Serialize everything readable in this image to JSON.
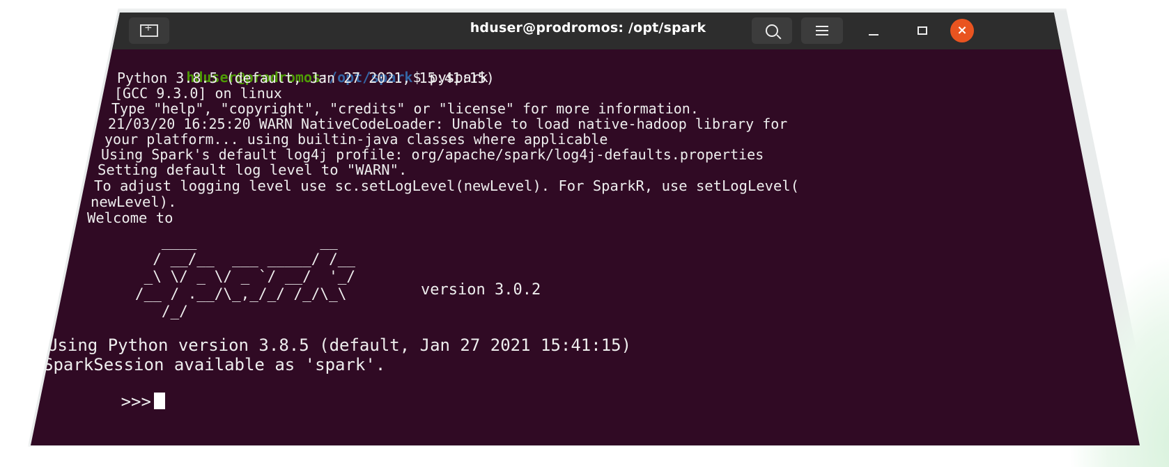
{
  "window": {
    "title": "hduser@prodromos: /opt/spark"
  },
  "colors": {
    "terminal_bg": "#300a24",
    "titlebar_bg": "#2d2d2d",
    "prompt_user": "#4e9a06",
    "prompt_path": "#3465a4",
    "close_button": "#e95420"
  },
  "icons": {
    "new_tab": "new-tab-icon",
    "search": "search-icon",
    "menu": "menu-icon",
    "minimize": "minimize-icon",
    "maximize": "maximize-icon",
    "close": "close-icon"
  },
  "terminal": {
    "prompt_user": "hduser@prodromos",
    "prompt_sep": ":",
    "prompt_path": "/opt/spark",
    "prompt_end": "$ pyspark",
    "lines": [
      "Python 3.8.5 (default, Jan 27 2021, 15:41:15)",
      "[GCC 9.3.0] on linux",
      "Type \"help\", \"copyright\", \"credits\" or \"license\" for more information.",
      "21/03/20 16:25:20 WARN NativeCodeLoader: Unable to load native-hadoop library for",
      "your platform... using builtin-java classes where applicable",
      "Using Spark's default log4j profile: org/apache/spark/log4j-defaults.properties",
      "Setting default log level to \"WARN\".",
      "To adjust logging level use sc.setLogLevel(newLevel). For SparkR, use setLogLevel(",
      "newLevel).",
      "Welcome to"
    ],
    "logo": "      ____              __\n     / __/__  ___ _____/ /__\n    _\\ \\/ _ \\/ _ `/ __/  '_/\n   /__ / .__/\\_,_/_/ /_/\\_\\\n      /_/",
    "version": "version 3.0.2",
    "python_version_line": "Using Python version 3.8.5 (default, Jan 27 2021 15:41:15)",
    "session_line": "SparkSession available as 'spark'.",
    "repl_prompt": ">>>"
  }
}
